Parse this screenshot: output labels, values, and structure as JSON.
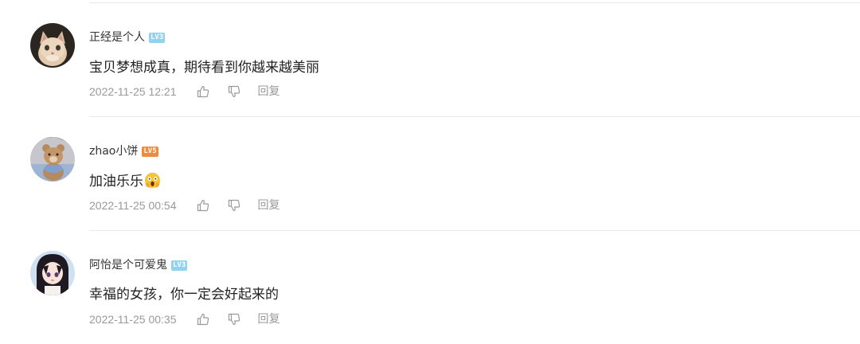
{
  "colors": {
    "text_primary": "#222222",
    "username": "#333333",
    "meta": "#999999",
    "divider": "#e9e9e9",
    "badge_lv3": "#8fd3f3",
    "badge_lv5": "#f08a3c"
  },
  "comments": [
    {
      "username": "正经是个人",
      "level": "LV3",
      "level_color": "#8fd3f3",
      "avatar_icon": "cat-avatar",
      "text": "宝贝梦想成真，期待看到你越来越美丽",
      "timestamp": "2022-11-25 12:21",
      "like_icon": "thumbs-up-icon",
      "dislike_icon": "thumbs-down-icon",
      "reply_label": "回复"
    },
    {
      "username": "zhao小饼",
      "level": "LV5",
      "level_color": "#f08a3c",
      "avatar_icon": "teddy-bear-avatar",
      "text": "加油乐乐",
      "emoji": "screaming-face-emoji",
      "timestamp": "2022-11-25 00:54",
      "like_icon": "thumbs-up-icon",
      "dislike_icon": "thumbs-down-icon",
      "reply_label": "回复"
    },
    {
      "username": "阿怡是个可爱鬼",
      "level": "LV3",
      "level_color": "#8fd3f3",
      "avatar_icon": "anime-girl-avatar",
      "text": "幸福的女孩，你一定会好起来的",
      "timestamp": "2022-11-25 00:35",
      "like_icon": "thumbs-up-icon",
      "dislike_icon": "thumbs-down-icon",
      "reply_label": "回复"
    }
  ]
}
